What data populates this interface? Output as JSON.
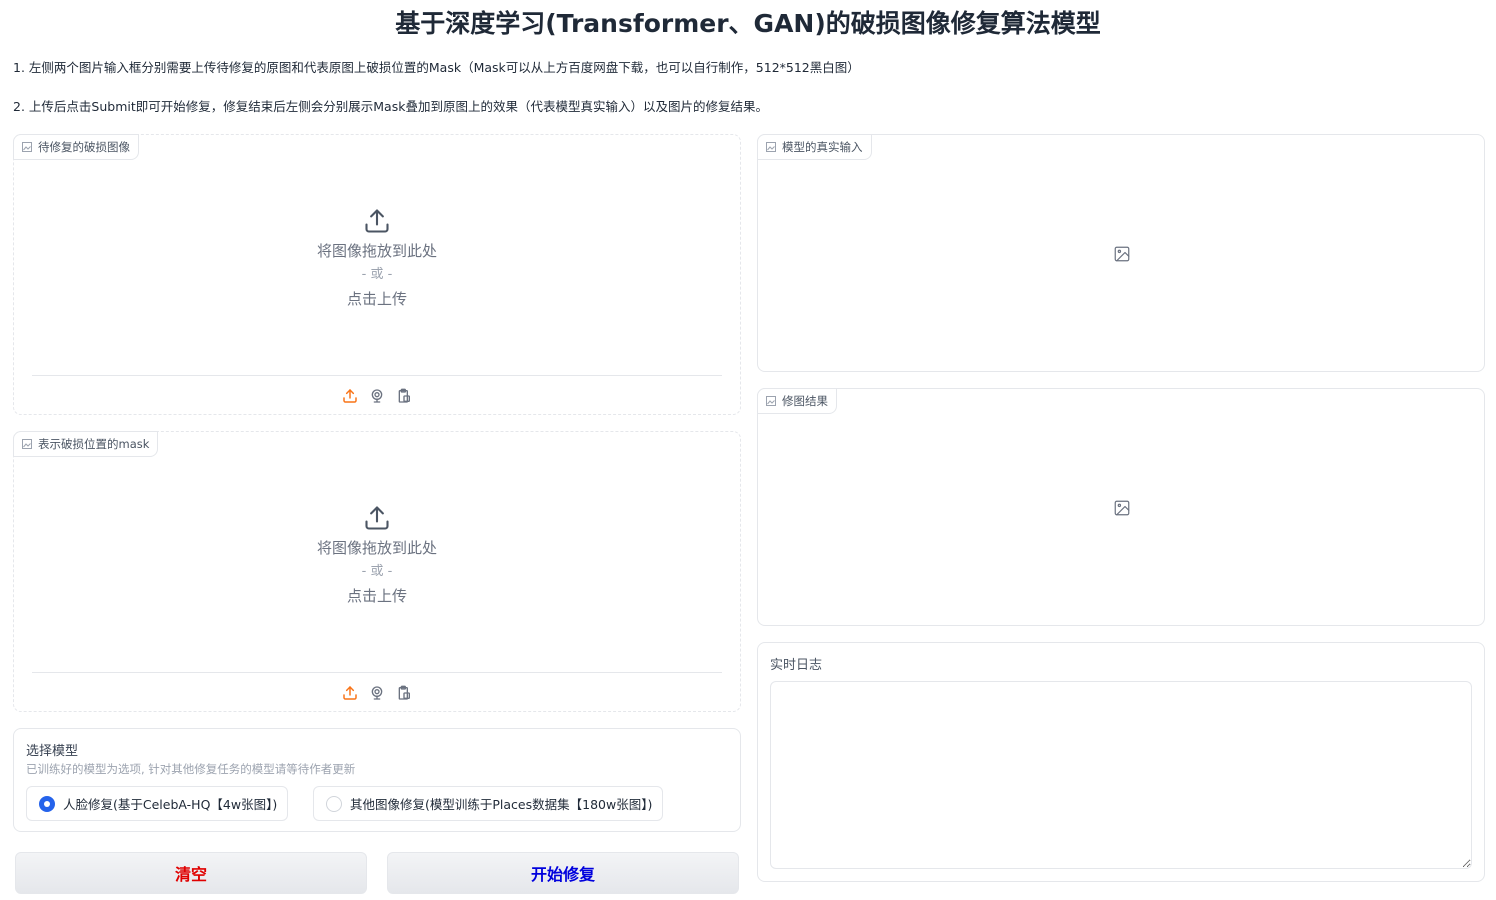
{
  "page": {
    "title": "基于深度学习(Transformer、GAN)的破损图像修复算法模型",
    "desc1": "1. 左侧两个图片输入框分别需要上传待修复的原图和代表原图上破损位置的Mask（Mask可以从上方百度网盘下载，也可以自行制作，512*512黑白图）",
    "desc2": "2. 上传后点击Submit即可开始修复，修复结束后左侧会分别展示Mask叠加到原图上的效果（代表模型真实输入）以及图片的修复结果。"
  },
  "inputs": {
    "damaged": {
      "label": "待修复的破损图像",
      "drop_text": "将图像拖放到此处",
      "or_text": "- 或 -",
      "click_text": "点击上传"
    },
    "mask": {
      "label": "表示破损位置的mask",
      "drop_text": "将图像拖放到此处",
      "or_text": "- 或 -",
      "click_text": "点击上传"
    }
  },
  "model_select": {
    "label": "选择模型",
    "info": "已训练好的模型为选项, 针对其他修复任务的模型请等待作者更新",
    "options": [
      {
        "label": "人脸修复(基于CelebA-HQ【4w张图】)",
        "selected": true
      },
      {
        "label": "其他图像修复(模型训练于Places数据集【180w张图】)",
        "selected": false
      }
    ]
  },
  "buttons": {
    "clear": {
      "label": "清空",
      "color": "#e00000"
    },
    "submit": {
      "label": "开始修复",
      "color": "#0000dd"
    }
  },
  "outputs": {
    "real_input": {
      "label": "模型的真实输入"
    },
    "result": {
      "label": "修图结果"
    }
  },
  "log": {
    "label": "实时日志",
    "value": ""
  },
  "icons": {
    "upload": "upload-icon",
    "webcam": "webcam-icon",
    "clipboard": "clipboard-icon",
    "image": "image-icon"
  },
  "colors": {
    "accent_orange": "#f97316",
    "radio_blue": "#2563eb"
  }
}
